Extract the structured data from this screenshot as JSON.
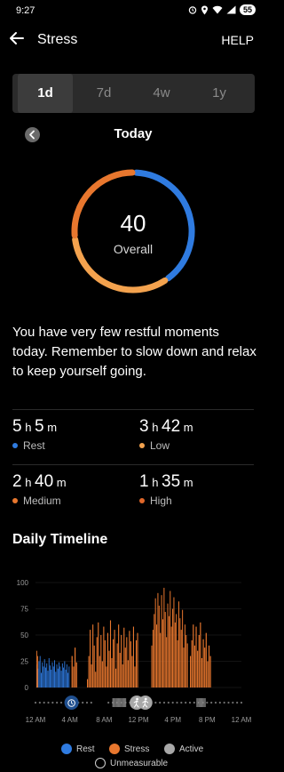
{
  "status_bar": {
    "time": "9:27",
    "battery": "55",
    "icons": [
      "alarm-icon",
      "location-icon",
      "wifi-icon",
      "signal-icon",
      "battery-icon"
    ]
  },
  "header": {
    "title": "Stress",
    "help_label": "HELP",
    "back_icon": "arrow-left-icon"
  },
  "period_tabs": [
    {
      "label": "1d",
      "active": true
    },
    {
      "label": "7d",
      "active": false
    },
    {
      "label": "4w",
      "active": false
    },
    {
      "label": "1y",
      "active": false
    }
  ],
  "date_nav": {
    "label": "Today",
    "prev_icon": "chevron-left-icon"
  },
  "score": {
    "value": "40",
    "label": "Overall",
    "ring_segments": [
      {
        "color": "#2f7be0",
        "fraction": 0.4
      },
      {
        "color": "#f3a24e",
        "fraction": 0.33
      },
      {
        "color": "#e8772e",
        "fraction": 0.27
      }
    ]
  },
  "message": "You have very few restful moments today. Remember to slow down and relax to keep yourself going.",
  "stats": [
    {
      "value_parts": [
        [
          "5",
          " h "
        ],
        [
          "5",
          " m"
        ]
      ],
      "label": "Rest",
      "color": "#2f7be0"
    },
    {
      "value_parts": [
        [
          "3",
          " h "
        ],
        [
          "42",
          " m"
        ]
      ],
      "label": "Low",
      "color": "#f3a24e"
    },
    {
      "value_parts": [
        [
          "2",
          " h "
        ],
        [
          "40",
          " m"
        ]
      ],
      "label": "Medium",
      "color": "#e8772e"
    },
    {
      "value_parts": [
        [
          "1",
          " h "
        ],
        [
          "35",
          " m"
        ]
      ],
      "label": "High",
      "color": "#e0672a"
    }
  ],
  "timeline": {
    "title": "Daily Timeline"
  },
  "chart_data": {
    "type": "bar",
    "title": "Daily Timeline",
    "xlabel": "",
    "ylabel": "",
    "ylim": [
      0,
      100
    ],
    "yticks": [
      "0",
      "25",
      "50",
      "75",
      "100"
    ],
    "xticks": [
      "12 AM",
      "4 AM",
      "8 AM",
      "12 PM",
      "4 PM",
      "8 PM",
      "12 AM"
    ],
    "x_range_hours": [
      0,
      24
    ],
    "series": [
      {
        "name": "Rest",
        "color": "#2f7be0",
        "segments": [
          {
            "start": 0.1,
            "end": 4.0,
            "values": [
              22,
              18,
              25,
              30,
              14,
              24,
              20,
              27,
              19,
              23,
              16,
              28,
              21,
              17,
              24,
              20,
              26,
              15,
              22,
              18,
              24,
              20,
              16,
              23,
              19,
              25,
              17,
              22,
              14,
              20
            ]
          }
        ]
      },
      {
        "name": "Stress",
        "color": "#e8772e",
        "segments": [
          {
            "start": 0.1,
            "end": 0.3,
            "values": [
              35,
              30
            ]
          },
          {
            "start": 4.2,
            "end": 4.9,
            "values": [
              30,
              20,
              38,
              24
            ]
          },
          {
            "start": 6.0,
            "end": 12.0,
            "values": [
              8,
              30,
              55,
              22,
              60,
              40,
              15,
              48,
              62,
              30,
              50,
              25,
              58,
              45,
              20,
              52,
              35,
              64,
              28,
              46,
              55,
              18,
              42,
              60,
              33,
              50,
              22,
              57,
              38,
              48,
              26,
              54,
              44,
              30,
              58,
              20,
              45,
              52
            ]
          },
          {
            "start": 13.5,
            "end": 17.8,
            "values": [
              40,
              55,
              70,
              85,
              60,
              90,
              78,
              52,
              88,
              65,
              95,
              72,
              48,
              80,
              68,
              92,
              58,
              75,
              86,
              62,
              70,
              45,
              82,
              66,
              55,
              74,
              38,
              60,
              50,
              42
            ]
          },
          {
            "start": 18.0,
            "end": 20.5,
            "values": [
              30,
              45,
              60,
              40,
              58,
              35,
              50,
              62,
              28,
              46,
              38,
              52,
              25,
              40,
              30
            ]
          }
        ]
      },
      {
        "name": "Active",
        "color": "#a8a8a8"
      },
      {
        "name": "Unmeasurable",
        "color": "#000000"
      }
    ]
  },
  "legend": [
    {
      "label": "Rest",
      "color": "#2f7be0"
    },
    {
      "label": "Stress",
      "color": "#e8772e"
    },
    {
      "label": "Active",
      "color": "#a8a8a8"
    },
    {
      "label": "Unmeasurable",
      "color": "none"
    }
  ]
}
